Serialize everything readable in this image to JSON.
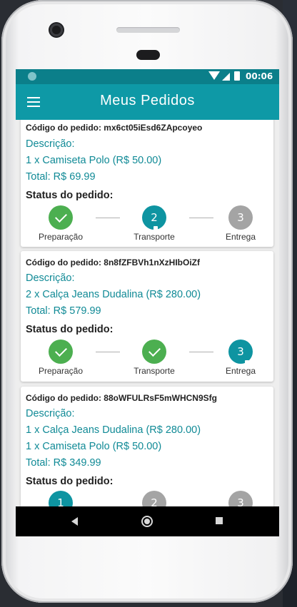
{
  "status_bar": {
    "time": "00:06"
  },
  "app_bar": {
    "title": "Meus Pedidos",
    "menu_icon": "hamburger-menu-icon"
  },
  "colors": {
    "primary": "#0e99a6",
    "primary_dark": "#0b7f8a",
    "done": "#4caf50",
    "pending": "#a4a4a4"
  },
  "orders": [
    {
      "code_label": "Código do pedido: mx6ct05iEsd6ZApcoyeo",
      "description_label": "Descrição:",
      "items": [
        "1 x Camiseta Polo (R$ 50.00)"
      ],
      "total": "Total: R$ 69.99",
      "status_label": "Status do pedido:",
      "steps": [
        {
          "label": "Preparação",
          "state": "done",
          "number": "1"
        },
        {
          "label": "Transporte",
          "state": "active",
          "number": "2"
        },
        {
          "label": "Entrega",
          "state": "pending",
          "number": "3"
        }
      ]
    },
    {
      "code_label": "Código do pedido: 8n8fZFBVh1nXzHIbOiZf",
      "description_label": "Descrição:",
      "items": [
        "2 x Calça Jeans Dudalina (R$ 280.00)"
      ],
      "total": "Total: R$ 579.99",
      "status_label": "Status do pedido:",
      "steps": [
        {
          "label": "Preparação",
          "state": "done",
          "number": "1"
        },
        {
          "label": "Transporte",
          "state": "done",
          "number": "2"
        },
        {
          "label": "Entrega",
          "state": "active",
          "number": "3"
        }
      ]
    },
    {
      "code_label": "Código do pedido: 88oWFULRsF5mWHCN9Sfg",
      "description_label": "Descrição:",
      "items": [
        "1 x Calça Jeans Dudalina (R$ 280.00)",
        "1 x Camiseta Polo (R$ 50.00)"
      ],
      "total": "Total: R$ 349.99",
      "status_label": "Status do pedido:",
      "steps": [
        {
          "label": "",
          "state": "active",
          "number": "1"
        },
        {
          "label": "",
          "state": "pending",
          "number": "2"
        },
        {
          "label": "",
          "state": "pending",
          "number": "3"
        }
      ]
    }
  ]
}
